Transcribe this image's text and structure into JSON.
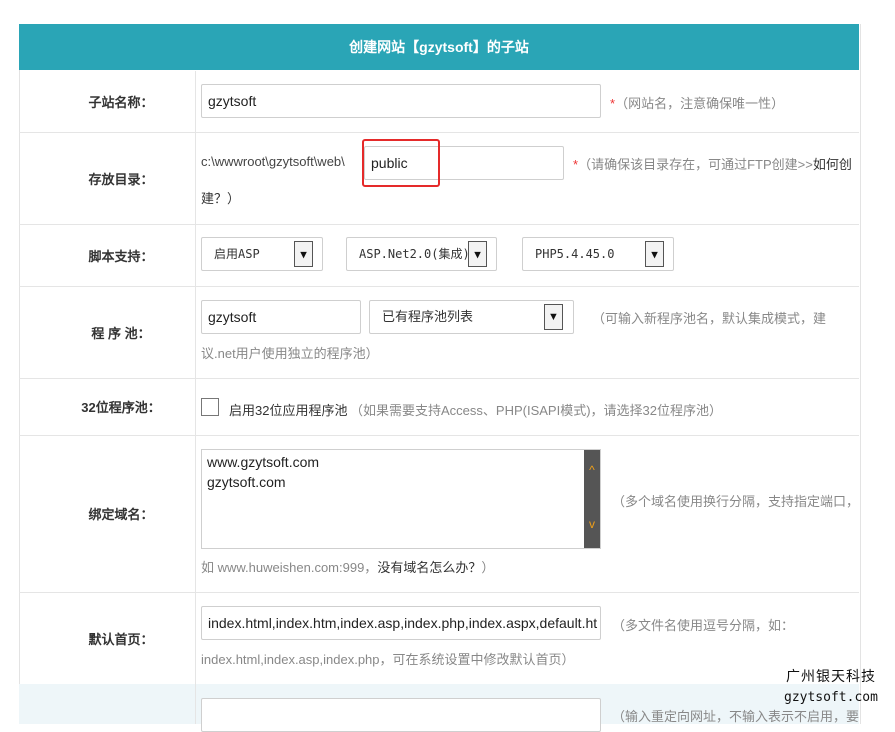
{
  "header": {
    "title": "创建网站【gzytsoft】的子站"
  },
  "site_name": {
    "label": "子站名称：",
    "value": "gzytsoft",
    "required": "*",
    "hint": "（网站名，注意确保唯一性）"
  },
  "directory": {
    "label": "存放目录：",
    "prefix": "c:\\wwwroot\\gzytsoft\\web\\",
    "value": "public",
    "required": "*",
    "hint_line1": "（请确保该目录存在，可通过FTP创建>>",
    "hint_link": "如何创",
    "hint_line2": "建？）"
  },
  "script_support": {
    "label": "脚本支持：",
    "asp": "启用ASP",
    "aspnet": "ASP.Net2.0(集成)",
    "php": "PHP5.4.45.0"
  },
  "app_pool": {
    "label": "程 序 池：",
    "value": "gzytsoft",
    "select": "已有程序池列表",
    "hint_line1": "（可输入新程序池名，默认集成模式，建",
    "hint_line2": "议.net用户使用独立的程序池）"
  },
  "pool32": {
    "label": "32位程序池：",
    "checkbox_label": "启用32位应用程序池",
    "hint": "（如果需要支持Access、PHP(ISAPI模式)，请选择32位程序池）"
  },
  "domains": {
    "label": "绑定域名：",
    "lines": [
      "www.gzytsoft.com",
      "gzytsoft.com"
    ],
    "hint": "（多个域名使用换行分隔，支持指定端口，",
    "example_prefix": "如 www.huweishen.com:999，",
    "example_link": "没有域名怎么办？",
    "example_suffix": "）"
  },
  "default_page": {
    "label": "默认首页：",
    "value": "index.html,index.htm,index.asp,index.php,index.aspx,default.ht",
    "hint_line1": "（多文件名使用逗号分隔，如：",
    "hint_line2": "index.html,index.asp,index.php，可在系统设置中修改默认首页）"
  },
  "redirect": {
    "hint": "（输入重定向网址，不输入表示不启用，要"
  },
  "watermark": {
    "line1": "广州银天科技",
    "line2": "gzytsoft.com"
  },
  "icons": {
    "dropdown": "chevron-down-icon",
    "scroll_up": "chevron-up-icon",
    "scroll_down": "chevron-down-icon"
  },
  "colors": {
    "header_bg": "#2aa5b6",
    "required": "#e33333",
    "highlight": "#e52a2a",
    "scroll_arrow": "#f0a019"
  }
}
